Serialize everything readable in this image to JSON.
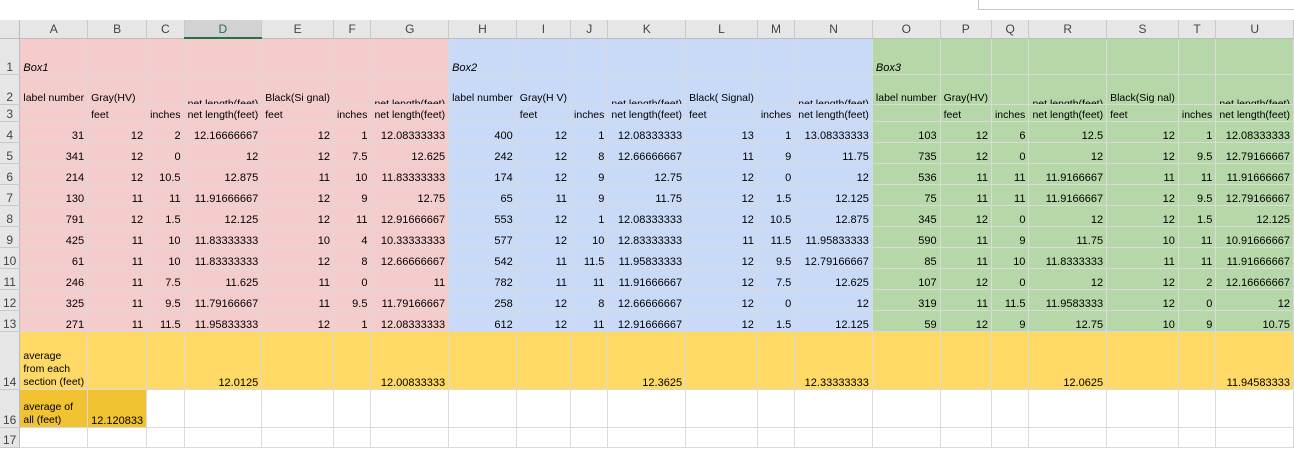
{
  "columns": [
    "A",
    "B",
    "C",
    "D",
    "E",
    "F",
    "G",
    "H",
    "I",
    "J",
    "K",
    "L",
    "M",
    "N",
    "O",
    "P",
    "Q",
    "R",
    "S",
    "T",
    "U"
  ],
  "selected_column": "D",
  "row_numbers": [
    "1",
    "2",
    "3",
    "4",
    "5",
    "6",
    "7",
    "8",
    "9",
    "10",
    "11",
    "12",
    "13",
    "14",
    "16",
    "17"
  ],
  "boxes": [
    {
      "title": "Box1",
      "label_header": "label number",
      "gray_header": "Gray(HV)",
      "black_header": "Black(Si gnal)",
      "feet": "feet",
      "inches": "inches",
      "net1": "net length(feet)",
      "net2": "net length(feet)"
    },
    {
      "title": "Box2",
      "label_header": "label number",
      "gray_header": "Gray(H V)",
      "black_header": "Black( Signal)",
      "feet": "feet",
      "inches": "inches",
      "net1": "net length(feet)",
      "net2": "net length(feet)"
    },
    {
      "title": "Box3",
      "label_header": "label number",
      "gray_header": "Gray(HV)",
      "black_header": "Black(Sig nal)",
      "feet": "feet",
      "inches": "inches",
      "net1": "net length(feet)",
      "net2": "net length(feet)"
    }
  ],
  "rows": [
    [
      "31",
      "12",
      "2",
      "12.16666667",
      "12",
      "1",
      "12.08333333",
      "400",
      "12",
      "1",
      "12.08333333",
      "13",
      "1",
      "13.08333333",
      "103",
      "12",
      "6",
      "12.5",
      "12",
      "1",
      "12.08333333"
    ],
    [
      "341",
      "12",
      "0",
      "12",
      "12",
      "7.5",
      "12.625",
      "242",
      "12",
      "8",
      "12.66666667",
      "11",
      "9",
      "11.75",
      "735",
      "12",
      "0",
      "12",
      "12",
      "9.5",
      "12.79166667"
    ],
    [
      "214",
      "12",
      "10.5",
      "12.875",
      "11",
      "10",
      "11.83333333",
      "174",
      "12",
      "9",
      "12.75",
      "12",
      "0",
      "12",
      "536",
      "11",
      "11",
      "11.9166667",
      "11",
      "11",
      "11.91666667"
    ],
    [
      "130",
      "11",
      "11",
      "11.91666667",
      "12",
      "9",
      "12.75",
      "65",
      "11",
      "9",
      "11.75",
      "12",
      "1.5",
      "12.125",
      "75",
      "11",
      "11",
      "11.9166667",
      "12",
      "9.5",
      "12.79166667"
    ],
    [
      "791",
      "12",
      "1.5",
      "12.125",
      "12",
      "11",
      "12.91666667",
      "553",
      "12",
      "1",
      "12.08333333",
      "12",
      "10.5",
      "12.875",
      "345",
      "12",
      "0",
      "12",
      "12",
      "1.5",
      "12.125"
    ],
    [
      "425",
      "11",
      "10",
      "11.83333333",
      "10",
      "4",
      "10.33333333",
      "577",
      "12",
      "10",
      "12.83333333",
      "11",
      "11.5",
      "11.95833333",
      "590",
      "11",
      "9",
      "11.75",
      "10",
      "11",
      "10.91666667"
    ],
    [
      "61",
      "11",
      "10",
      "11.83333333",
      "12",
      "8",
      "12.66666667",
      "542",
      "11",
      "11.5",
      "11.95833333",
      "12",
      "9.5",
      "12.79166667",
      "85",
      "11",
      "10",
      "11.8333333",
      "11",
      "11",
      "11.91666667"
    ],
    [
      "246",
      "11",
      "7.5",
      "11.625",
      "11",
      "0",
      "11",
      "782",
      "11",
      "11",
      "11.91666667",
      "12",
      "7.5",
      "12.625",
      "107",
      "12",
      "0",
      "12",
      "12",
      "2",
      "12.16666667"
    ],
    [
      "325",
      "11",
      "9.5",
      "11.79166667",
      "11",
      "9.5",
      "11.79166667",
      "258",
      "12",
      "8",
      "12.66666667",
      "12",
      "0",
      "12",
      "319",
      "11",
      "11.5",
      "11.9583333",
      "12",
      "0",
      "12"
    ],
    [
      "271",
      "11",
      "11.5",
      "11.95833333",
      "12",
      "1",
      "12.08333333",
      "612",
      "12",
      "11",
      "12.91666667",
      "12",
      "1.5",
      "12.125",
      "59",
      "12",
      "9",
      "12.75",
      "10",
      "9",
      "10.75"
    ]
  ],
  "average_row": {
    "label": "average from each section (feet)",
    "d": "12.0125",
    "g": "12.00833333",
    "k": "12.3625",
    "n": "12.33333333",
    "r": "12.0625",
    "u": "11.94583333"
  },
  "average_all": {
    "label": "average of all (feet)",
    "value": "12.120833"
  },
  "colors": {
    "box1": "#f4cccc",
    "box2": "#c9daf8",
    "box3": "#b6d7a8",
    "average_band": "#ffd966",
    "average_all": "#f1c232",
    "selected_header": "#217346"
  }
}
